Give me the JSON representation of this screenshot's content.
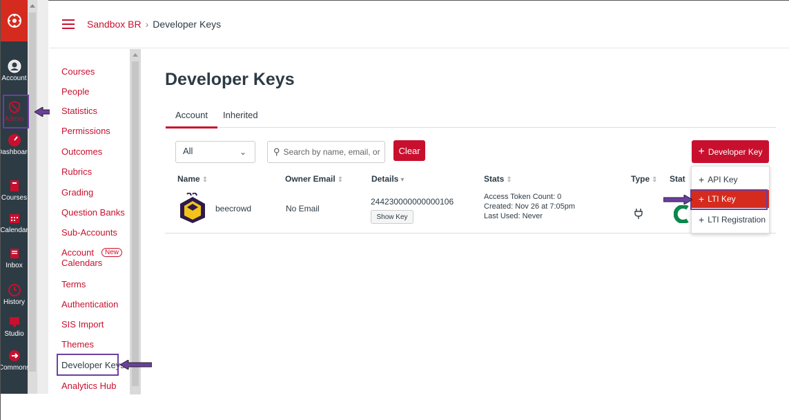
{
  "global_nav": {
    "items": [
      {
        "label": "Account",
        "icon": "user-icon"
      },
      {
        "label": "Admin",
        "icon": "shield-icon"
      },
      {
        "label": "Dashboard",
        "icon": "dashboard-icon"
      },
      {
        "label": "Courses",
        "icon": "book-icon"
      },
      {
        "label": "Calendar",
        "icon": "calendar-icon"
      },
      {
        "label": "Inbox",
        "icon": "inbox-icon"
      },
      {
        "label": "History",
        "icon": "clock-icon"
      },
      {
        "label": "Studio",
        "icon": "studio-icon"
      },
      {
        "label": "Commons",
        "icon": "commons-icon"
      }
    ]
  },
  "header": {
    "breadcrumb_root": "Sandbox BR",
    "breadcrumb_sep": "›",
    "breadcrumb_current": "Developer Keys"
  },
  "subnav": {
    "items": [
      "Courses",
      "People",
      "Statistics",
      "Permissions",
      "Outcomes",
      "Rubrics",
      "Grading",
      "Question Banks",
      "Sub-Accounts",
      "Account Calendars",
      "Terms",
      "Authentication",
      "SIS Import",
      "Themes",
      "Developer Keys",
      "Analytics Hub"
    ],
    "new_badge": "New"
  },
  "main": {
    "title": "Developer Keys",
    "tabs": [
      "Account",
      "Inherited"
    ],
    "filter_value": "All",
    "search_placeholder": "Search by name, email, or",
    "clear_label": "Clear",
    "add_button": "Developer Key",
    "columns": {
      "name": "Name",
      "owner": "Owner Email",
      "details": "Details",
      "stats": "Stats",
      "type": "Type",
      "state": "Stat"
    },
    "row": {
      "name": "beecrowd",
      "owner": "No Email",
      "details_id": "244230000000000106",
      "show_key": "Show Key",
      "stats_tokens": "Access Token Count: 0",
      "stats_created": "Created: Nov 26 at 7:05pm",
      "stats_used": "Last Used: Never"
    },
    "menu": [
      "API Key",
      "LTI Key",
      "LTI Registration"
    ]
  },
  "colors": {
    "brand": "#c8102e",
    "nav_bg": "#2d3b45",
    "highlight": "#6b3fa0"
  }
}
